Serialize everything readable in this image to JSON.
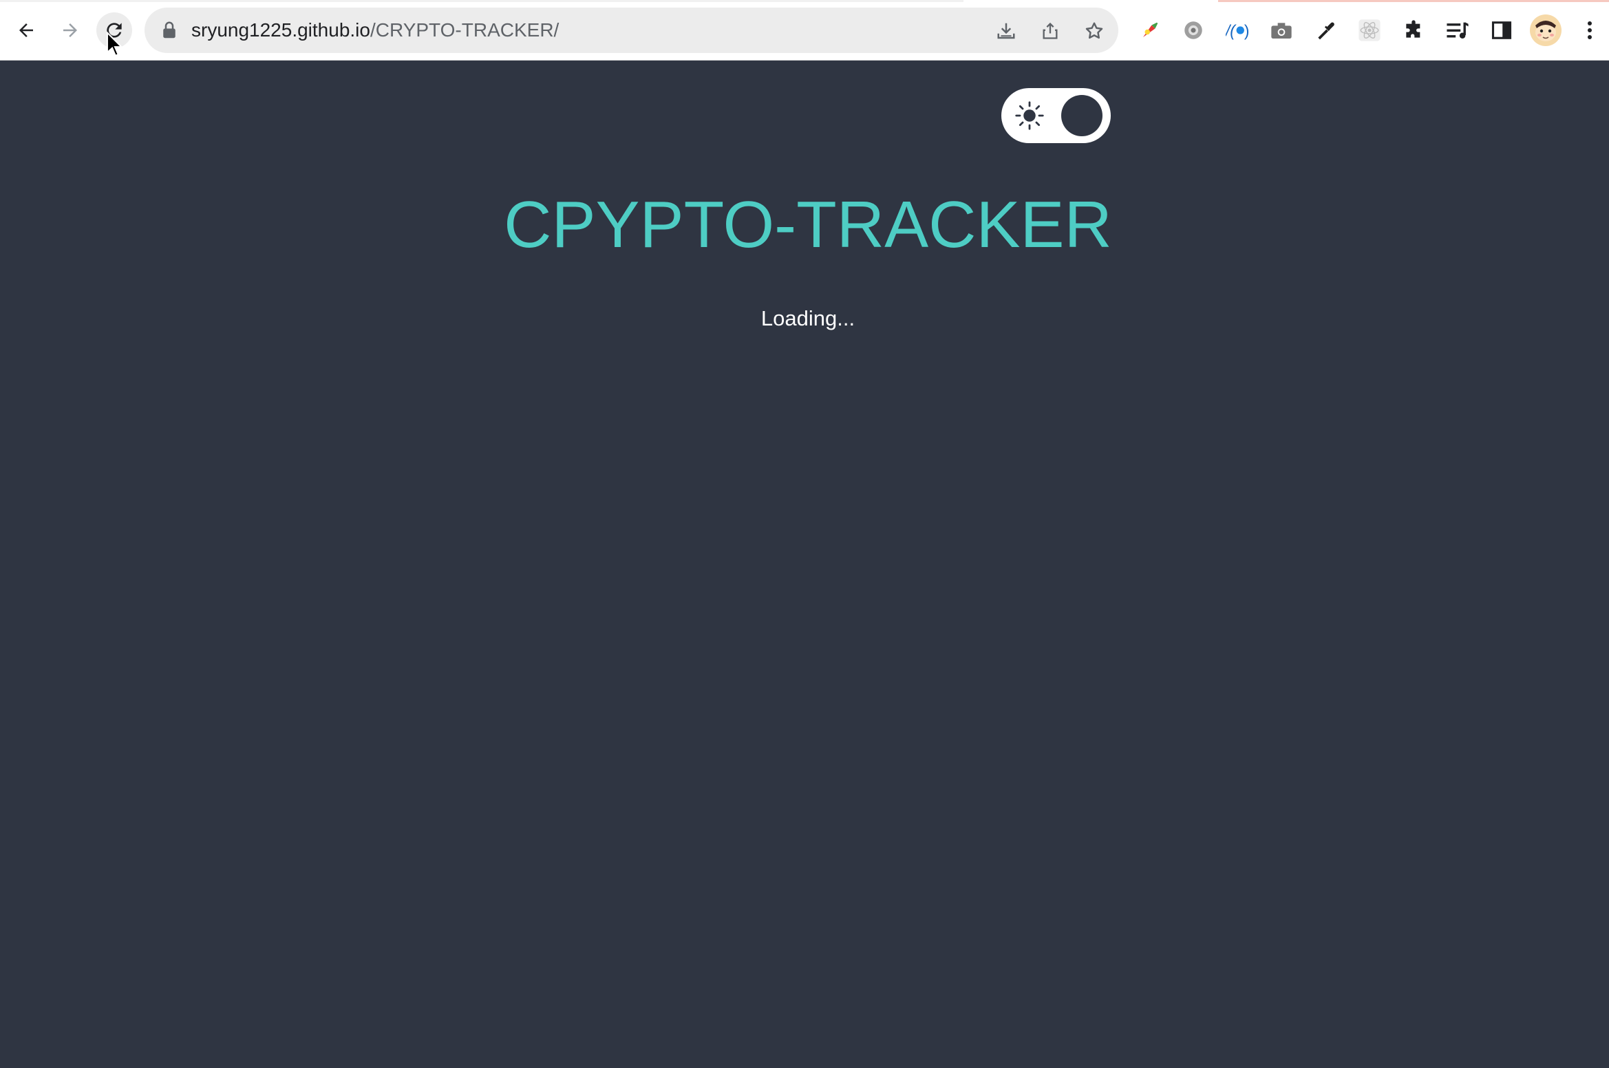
{
  "browser": {
    "url_host": "sryung1225.github.io",
    "url_path": "/CRYPTO-TRACKER/",
    "nav": {
      "back_icon": "back-arrow-icon",
      "forward_icon": "forward-arrow-icon",
      "reload_icon": "reload-icon"
    },
    "omnibox_icons": [
      "lock-icon",
      "install-app-icon",
      "share-icon",
      "bookmark-star-icon"
    ],
    "extensions": [
      "color-picker-extension-icon",
      "settings-extension-icon",
      "api-extension-icon",
      "camera-extension-icon",
      "eyedropper-extension-icon",
      "react-devtools-extension-icon",
      "puzzle-extensions-icon",
      "media-control-icon",
      "side-panel-icon",
      "profile-avatar",
      "menu-kebab-icon"
    ]
  },
  "theme_toggle": {
    "icon": "sun-icon",
    "state": "dark"
  },
  "page": {
    "title": "CPYPTO-TRACKER",
    "status": "Loading..."
  },
  "colors": {
    "background": "#2f3542",
    "accent": "#4ecdc4",
    "text": "#ffffff"
  }
}
